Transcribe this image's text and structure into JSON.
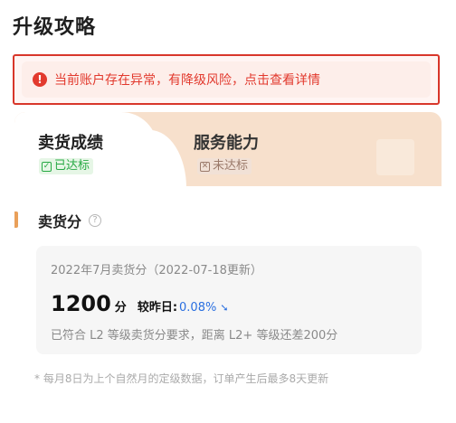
{
  "page": {
    "title": "升级攻略"
  },
  "alert": {
    "icon": "warning-icon",
    "text": "当前账户存在异常，有降级风险，点击查看详情",
    "color": "#e23a2e"
  },
  "tabs": [
    {
      "label": "卖货成绩",
      "badge": "已达标",
      "status": "achieved",
      "active": true
    },
    {
      "label": "服务能力",
      "badge": "未达标",
      "status": "not-achieved",
      "active": false
    }
  ],
  "section": {
    "title": "卖货分",
    "help_icon": "help-icon",
    "accent": "#e9a05a"
  },
  "score": {
    "period": "2022年7月卖货分（2022-07-18更新）",
    "value": "1200",
    "unit": "分",
    "compare_label": "较昨日:",
    "compare_value": "0.08%",
    "trend_icon": "arrow-down-icon",
    "trend_color": "#2a6fe0",
    "description": "已符合 L2 等级卖货分要求，距离 L2+ 等级还差200分"
  },
  "footnote": "* 每月8日为上个自然月的定级数据，订单产生后最多8天更新"
}
